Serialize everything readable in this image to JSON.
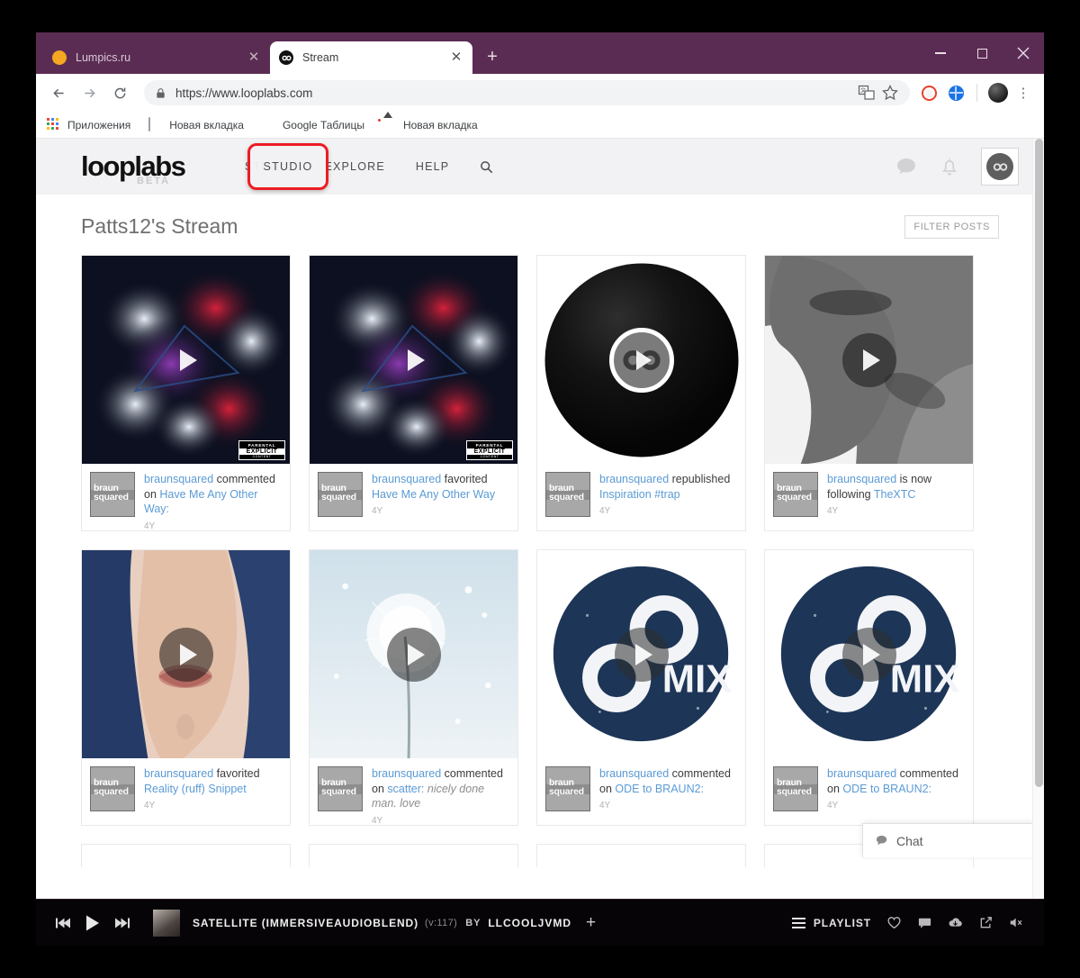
{
  "browser": {
    "tabs": [
      {
        "title": "Lumpics.ru",
        "favicon": "orange-dot-icon",
        "active": false
      },
      {
        "title": "Stream",
        "favicon": "looplabs-logo-icon",
        "active": true
      }
    ],
    "new_tab_label": "+",
    "window_controls": {
      "minimize": "–",
      "maximize": "□",
      "close": "✕"
    },
    "toolbar": {
      "back": "back-arrow",
      "forward": "forward-arrow",
      "reload": "reload-arrow",
      "url": "https://www.looplabs.com",
      "lock": "lock-icon",
      "translate": "translate-icon",
      "bookmark_star": "star-icon",
      "ext_adblock": "adblock-icon",
      "ext_globe": "globe-extension-icon",
      "profile": "profile-avatar",
      "menu": "⋮"
    },
    "bookmarks": [
      {
        "label": "Приложения",
        "icon": "apps-grid-icon"
      },
      {
        "label": "Новая вкладка",
        "icon": "document-icon"
      },
      {
        "label": "Google Таблицы",
        "icon": "google-sheets-icon"
      },
      {
        "label": "Новая вкладка",
        "icon": "image-icon"
      }
    ]
  },
  "site": {
    "logo": "looplabs",
    "logo_sub": "BETA",
    "nav": [
      {
        "label": "STUDIO",
        "highlighted": true
      },
      {
        "label": "EXPLORE",
        "highlighted": false
      },
      {
        "label": "HELP",
        "highlighted": false
      }
    ],
    "search_icon": "search-icon",
    "header_icons": [
      "chat-bubble-icon",
      "bell-icon",
      "user-avatar-loop-icon"
    ],
    "highlight_color": "#ec1c24"
  },
  "stream": {
    "title": "Patts12's Stream",
    "filter_label": "FILTER POSTS",
    "cards": [
      {
        "thumb": "red-blue-smoke-artwork",
        "thumb_kind": "smoke",
        "explicit_badge": "PARENTAL ADVISORY EXPLICIT CONTENT",
        "user": "braunsquared",
        "action": "commented on",
        "target": "Have Me Any Other Way:",
        "extra": "",
        "age": "4Y",
        "avatar_text": "braun squared"
      },
      {
        "thumb": "red-blue-smoke-artwork",
        "thumb_kind": "smoke",
        "explicit_badge": "PARENTAL ADVISORY EXPLICIT CONTENT",
        "user": "braunsquared",
        "action": "favorited",
        "target": "Have Me Any Other Way",
        "extra": "",
        "age": "4Y",
        "avatar_text": "braun squared"
      },
      {
        "thumb": "black-vinyl-record",
        "thumb_kind": "vinyl",
        "explicit_badge": "",
        "user": "braunsquared",
        "action": "republished",
        "target": "Inspiration #trap",
        "extra": "",
        "age": "4Y",
        "avatar_text": "braun squared"
      },
      {
        "thumb": "man-portrait-bw",
        "thumb_kind": "portrait-bw",
        "explicit_badge": "",
        "user": "braunsquared",
        "action": "is now following",
        "target": "TheXTC",
        "extra": "",
        "age": "4Y",
        "avatar_text": "braun squared"
      },
      {
        "thumb": "woman-blue-hair",
        "thumb_kind": "woman",
        "explicit_badge": "",
        "user": "braunsquared",
        "action": "favorited",
        "target": "Reality (ruff) Snippet",
        "extra": "",
        "age": "4Y",
        "avatar_text": "braun squared"
      },
      {
        "thumb": "dandelion-sky",
        "thumb_kind": "dandelion",
        "explicit_badge": "",
        "user": "braunsquared",
        "action": "commented on",
        "target": "scatter:",
        "extra": "nicely done man. love",
        "age": "4Y",
        "avatar_text": "braun squared"
      },
      {
        "thumb": "navy-mix-logo",
        "thumb_kind": "mix",
        "mix_label": "MIX",
        "explicit_badge": "",
        "user": "braunsquared",
        "action": "commented on",
        "target": "ODE to BRAUN2:",
        "extra": "",
        "age": "4Y",
        "avatar_text": "braun squared"
      },
      {
        "thumb": "navy-mix-logo",
        "thumb_kind": "mix",
        "mix_label": "MIX",
        "explicit_badge": "",
        "user": "braunsquared",
        "action": "commented on",
        "target": "ODE to BRAUN2:",
        "extra": "",
        "age": "4Y",
        "avatar_text": "braun squared"
      }
    ]
  },
  "chat_widget": {
    "label": "Chat",
    "icon": "chat-bubble-icon"
  },
  "player": {
    "prev": "previous-track-icon",
    "play": "play-icon",
    "next": "next-track-icon",
    "track_title": "SATELLITE (IMMERSIVEAUDIOBLEND)",
    "version": "(v:117)",
    "by_label": "BY",
    "artist": "LLCOOLJVMD",
    "add": "+",
    "playlist_label": "PLAYLIST",
    "icons": [
      "heart-icon",
      "comment-icon",
      "download-cloud-icon",
      "share-icon",
      "mute-speaker-icon"
    ]
  }
}
